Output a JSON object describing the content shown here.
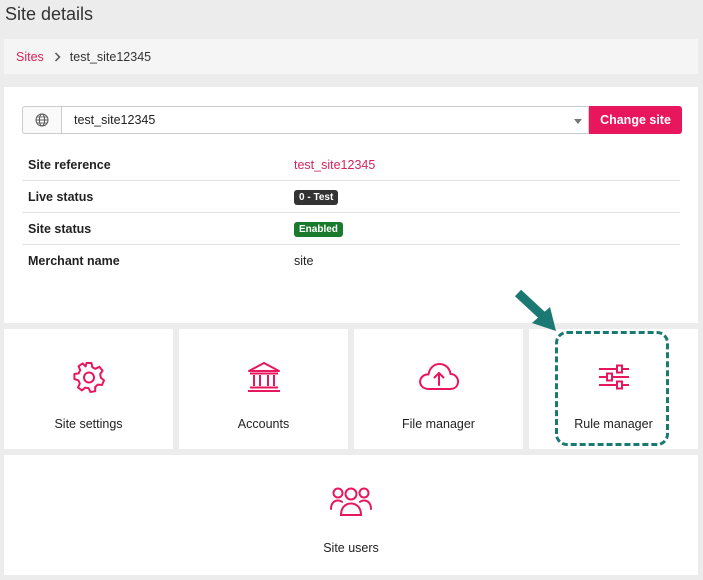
{
  "page": {
    "title": "Site details"
  },
  "breadcrumb": {
    "root": "Sites",
    "current": "test_site12345"
  },
  "site_selector": {
    "value": "test_site12345",
    "button_label": "Change site"
  },
  "details": [
    {
      "label": "Site reference",
      "value": "test_site12345"
    },
    {
      "label": "Live status",
      "value": "0 - Test"
    },
    {
      "label": "Site status",
      "value": "Enabled"
    },
    {
      "label": "Merchant name",
      "value": "site"
    }
  ],
  "tiles": {
    "site_settings": {
      "label": "Site settings",
      "icon": "gear-icon"
    },
    "accounts": {
      "label": "Accounts",
      "icon": "bank-icon"
    },
    "file_manager": {
      "label": "File manager",
      "icon": "cloud-upload-icon"
    },
    "rule_manager": {
      "label": "Rule manager",
      "icon": "sliders-icon"
    },
    "site_users": {
      "label": "Site users",
      "icon": "users-icon"
    }
  },
  "colors": {
    "accent": "#e8175d",
    "link": "#d6245b",
    "highlight": "#1a7a73",
    "badge_test": "#333333",
    "badge_enabled": "#1a7a2c"
  }
}
